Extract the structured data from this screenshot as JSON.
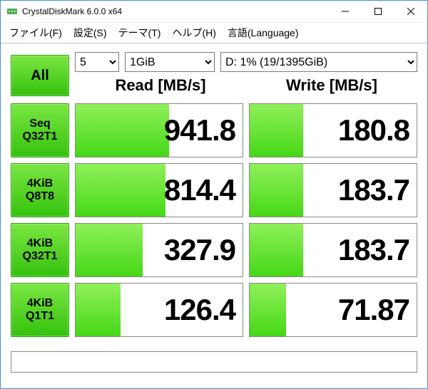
{
  "window": {
    "title": "CrystalDiskMark 6.0.0 x64"
  },
  "menu": {
    "file": "ファイル(F)",
    "settings": "設定(S)",
    "theme": "テーマ(T)",
    "help": "ヘルプ(H)",
    "language": "言語(Language)"
  },
  "controls": {
    "all_label": "All",
    "count": "5",
    "size": "1GiB",
    "drive": "D: 1% (19/1395GiB)"
  },
  "headers": {
    "read": "Read [MB/s]",
    "write": "Write [MB/s]"
  },
  "tests": [
    {
      "l1": "Seq",
      "l2": "Q32T1",
      "read": "941.8",
      "write": "180.8",
      "rfill": 56,
      "wfill": 32
    },
    {
      "l1": "4KiB",
      "l2": "Q8T8",
      "read": "814.4",
      "write": "183.7",
      "rfill": 54,
      "wfill": 32
    },
    {
      "l1": "4KiB",
      "l2": "Q32T1",
      "read": "327.9",
      "write": "183.7",
      "rfill": 40,
      "wfill": 32
    },
    {
      "l1": "4KiB",
      "l2": "Q1T1",
      "read": "126.4",
      "write": "71.87",
      "rfill": 27,
      "wfill": 22
    }
  ],
  "chart_data": {
    "type": "table",
    "title": "CrystalDiskMark 6.0.0 x64 benchmark results",
    "unit": "MB/s",
    "tests": [
      "Seq Q32T1",
      "4KiB Q8T8",
      "4KiB Q32T1",
      "4KiB Q1T1"
    ],
    "series": [
      {
        "name": "Read",
        "values": [
          941.8,
          814.4,
          327.9,
          126.4
        ]
      },
      {
        "name": "Write",
        "values": [
          180.8,
          183.7,
          183.7,
          71.87
        ]
      }
    ]
  }
}
